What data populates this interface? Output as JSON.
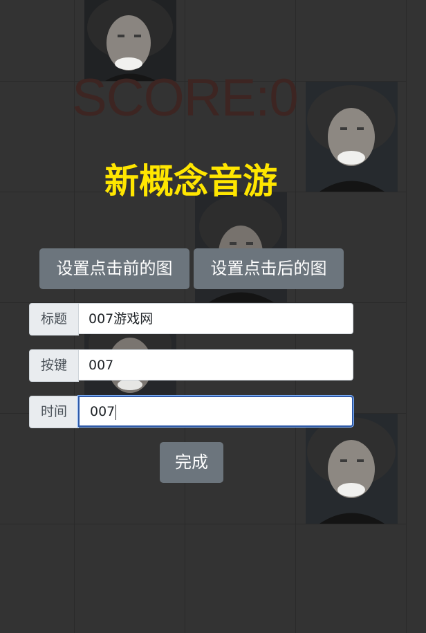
{
  "score": {
    "text": "SCORE:0"
  },
  "game_title": "新概念音游",
  "buttons": {
    "set_before_image": "设置点击前的图",
    "set_after_image": "设置点击后的图",
    "done": "完成"
  },
  "form": {
    "title_label": "标题",
    "title_value": "007游戏网",
    "key_label": "按键",
    "key_value": "007",
    "time_label": "时间",
    "time_value": "007"
  },
  "colors": {
    "background": "#333333",
    "title_yellow": "#ffe600",
    "button_gray": "#6c757d",
    "score_text": "#3d2522"
  }
}
